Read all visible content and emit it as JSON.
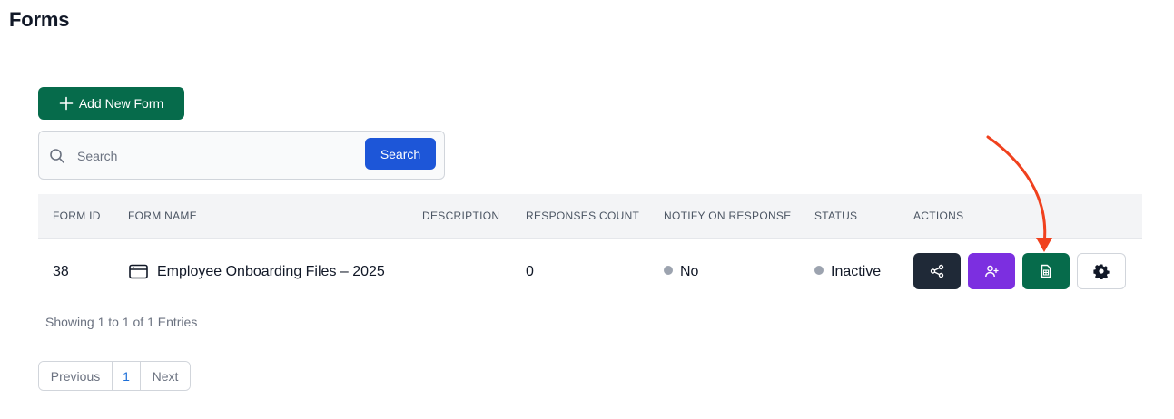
{
  "page": {
    "title": "Forms"
  },
  "toolbar": {
    "add_label": "Add New Form"
  },
  "search": {
    "placeholder": "Search",
    "value": "",
    "button_label": "Search"
  },
  "table": {
    "headers": [
      "FORM ID",
      "FORM NAME",
      "DESCRIPTION",
      "RESPONSES COUNT",
      "NOTIFY ON RESPONSE",
      "STATUS",
      "ACTIONS"
    ],
    "rows": [
      {
        "form_id": "38",
        "form_name": "Employee Onboarding Files – 2025",
        "description": "",
        "responses_count": "0",
        "notify_on_response": "No",
        "status": "Inactive",
        "actions": [
          "share-icon",
          "assign-user-icon",
          "spreadsheet-icon",
          "gear-icon"
        ]
      }
    ]
  },
  "footer": {
    "info": "Showing 1 to 1 of 1 Entries"
  },
  "pagination": {
    "previous": "Previous",
    "current": "1",
    "next": "Next"
  },
  "colors": {
    "primary_green": "#066b4b",
    "search_blue": "#1d56d8",
    "share_dark": "#1f2937",
    "assign_purple": "#7c2fe0",
    "annotation_arrow": "#f0411e"
  }
}
